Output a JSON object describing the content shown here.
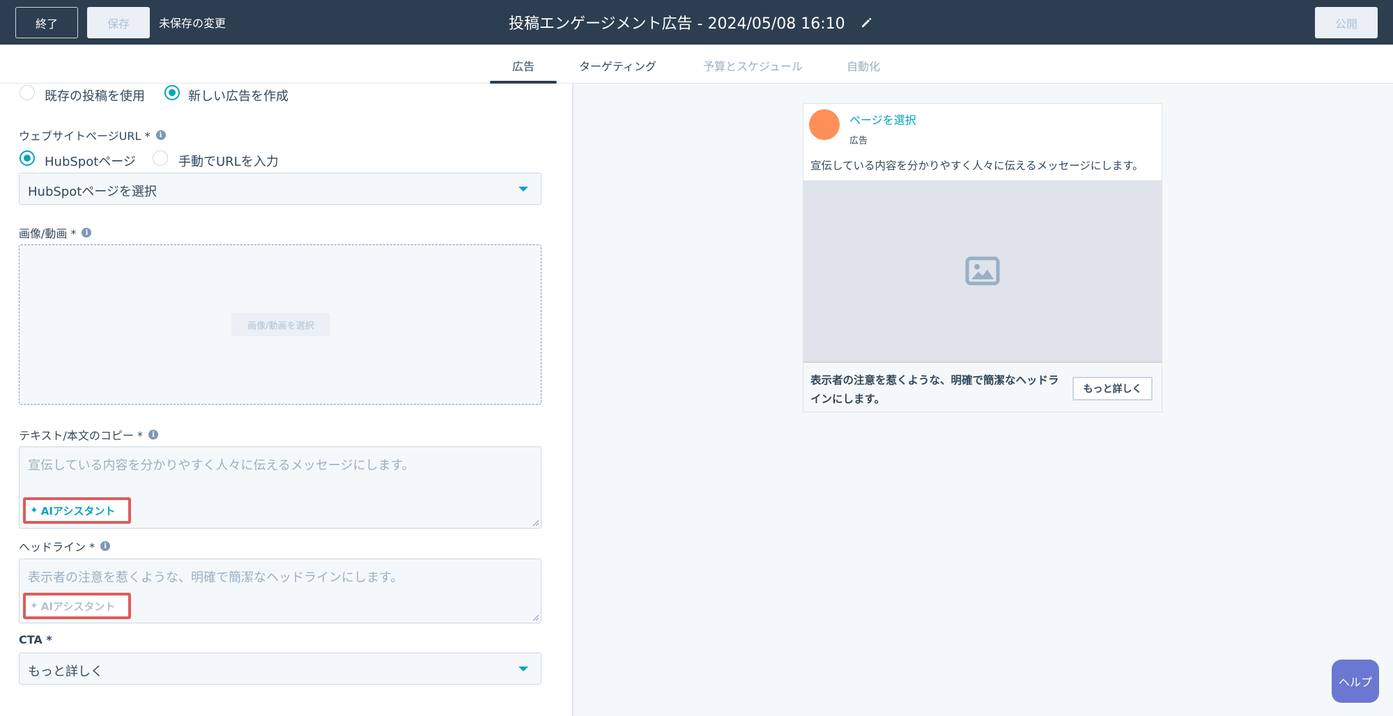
{
  "topbar": {
    "exit_label": "終了",
    "save_label": "保存",
    "unsaved_text": "未保存の変更",
    "title": "投稿エンゲージメント広告 - 2024/05/08 16:10",
    "publish_label": "公開",
    "color": "#2d3e50"
  },
  "tabs": [
    {
      "label": "広告",
      "state": "active"
    },
    {
      "label": "ターゲティング",
      "state": "normal"
    },
    {
      "label": "予算とスケジュール",
      "state": "disabled"
    },
    {
      "label": "自動化",
      "state": "disabled"
    }
  ],
  "form": {
    "source": {
      "option_existing": "既存の投稿を使用",
      "option_new": "新しい広告を作成",
      "selected": "new"
    },
    "url": {
      "label": "ウェブサイトページURL *",
      "option_hubspot": "HubSpotページ",
      "option_manual": "手動でURLを入力",
      "selected": "hubspot",
      "select_value": "HubSpotページを選択"
    },
    "media": {
      "label": "画像/動画 *",
      "button": "画像/動画を選択"
    },
    "body_copy": {
      "label": "テキスト/本文のコピー *",
      "placeholder": "宣伝している内容を分かりやすく人々に伝えるメッセージにします。",
      "ai_label": "AIアシスタント"
    },
    "headline": {
      "label": "ヘッドライン *",
      "placeholder": "表示者の注意を惹くような、明確で簡潔なヘッドラインにします。",
      "ai_label": "AIアシスタント"
    },
    "cta": {
      "label": "CTA *",
      "value": "もっと詳しく"
    }
  },
  "preview": {
    "page_link": "ページを選択",
    "ad_label": "広告",
    "body": "宣伝している内容を分かりやすく人々に伝えるメッセージにします。",
    "headline": "表示者の注意を惹くような、明確で簡潔なヘッドラインにします。",
    "cta": "もっと詳しく",
    "avatar_color": "#ff8f59"
  },
  "help_label": "ヘルプ",
  "accent": "#00a4bd"
}
